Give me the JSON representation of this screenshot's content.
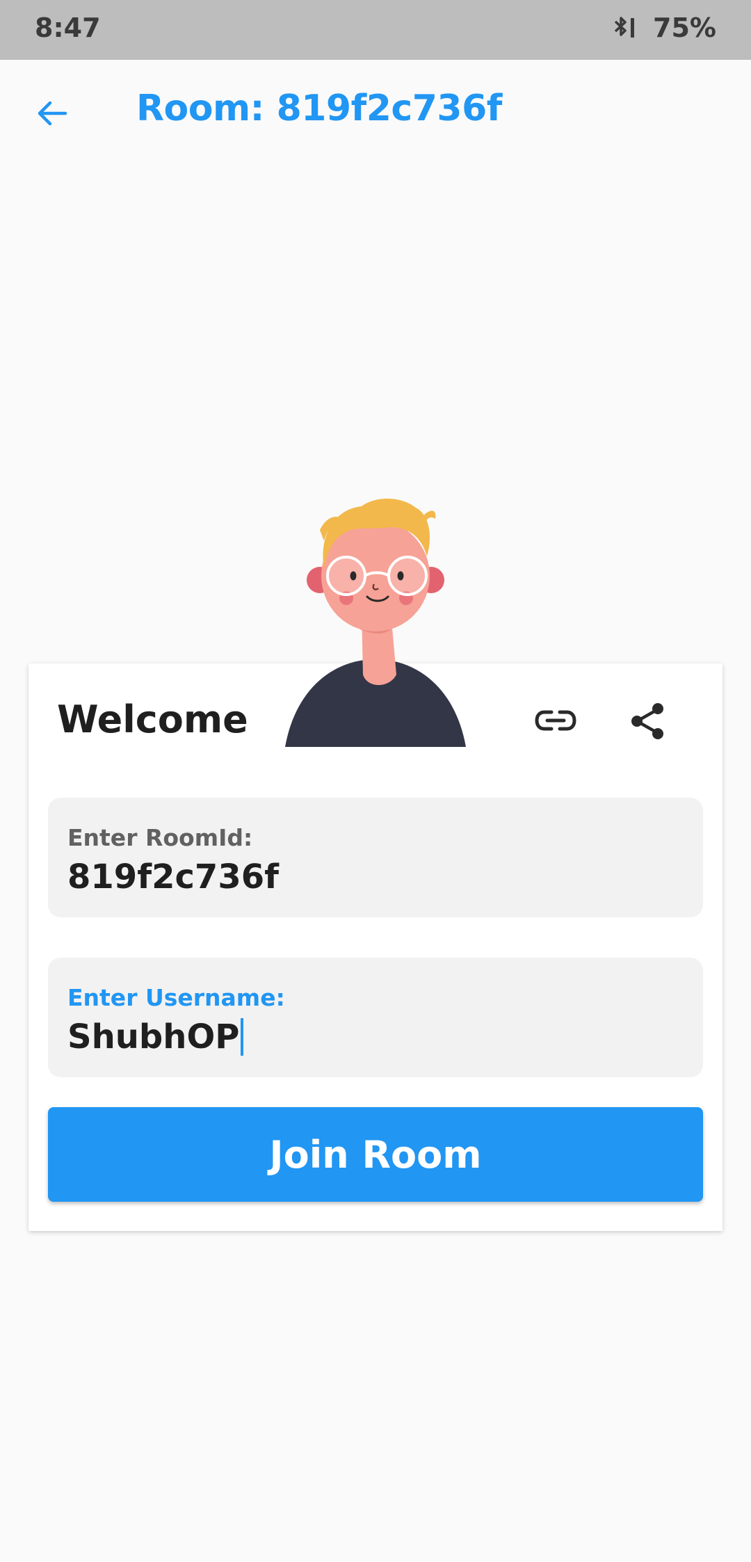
{
  "status_bar": {
    "time": "8:47",
    "battery": "75%",
    "bluetooth_icon": "bluetooth-icon"
  },
  "app_bar": {
    "back_icon": "arrow-back-icon",
    "title": "Room: 819f2c736f"
  },
  "card": {
    "welcome": "Welcome",
    "link_icon": "link-icon",
    "share_icon": "share-icon",
    "room_field": {
      "label": "Enter RoomId:",
      "value": "819f2c736f"
    },
    "username_field": {
      "label": "Enter Username:",
      "value": "ShubhOP"
    },
    "join_button": "Join Room"
  },
  "colors": {
    "accent": "#2196f3",
    "status_bar": "#bdbdbd",
    "field_bg": "#f2f2f2",
    "avatar_shirt": "#333647",
    "avatar_hair": "#f2b84b",
    "avatar_skin": "#f7a296"
  }
}
